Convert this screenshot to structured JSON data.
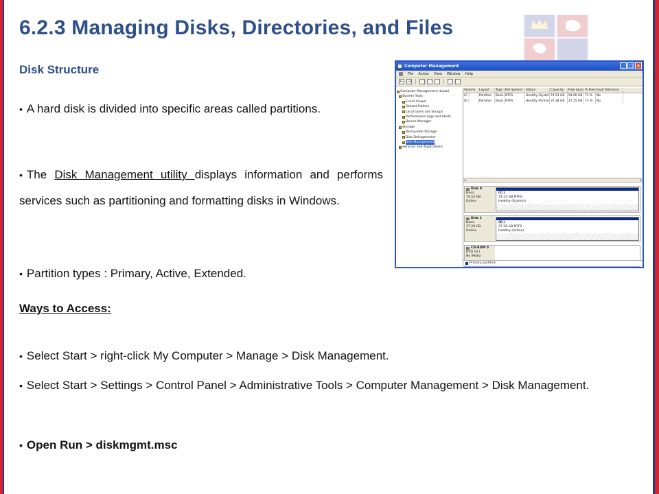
{
  "slide": {
    "title": "6.2.3 Managing Disks, Directories, and Files",
    "subhead": "Disk Structure",
    "bullets": {
      "b1": "A hard disk is divided into specific areas called partitions.",
      "b2_pre": "The ",
      "b2_link": "Disk Management utility ",
      "b2_post": "displays information and performs services such as partitioning and formatting disks in Windows.",
      "b3": "Partition types : Primary, Active, Extended."
    },
    "ways_heading": "Ways to Access:",
    "access": {
      "a1": "Select Start > right-click My Computer > Manage > Disk Management.",
      "a2": "Select Start > Settings > Control Panel > Administrative Tools > Computer Management > Disk Management.",
      "a3": "Open Run > diskmgmt.msc"
    },
    "bullet_glyph": "•"
  },
  "window": {
    "title": "Computer Management",
    "controls": {
      "min": "_",
      "max": "□",
      "close": "x"
    },
    "menu": [
      "File",
      "Action",
      "View",
      "Window",
      "Help"
    ],
    "tree": [
      "Computer Management (Local)",
      "System Tools",
      "Event Viewer",
      "Shared Folders",
      "Local Users and Groups",
      "Performance Logs and Alerts",
      "Device Manager",
      "Storage",
      "Removable Storage",
      "Disk Defragmenter",
      "Disk Management",
      "Services and Applications"
    ],
    "vol_headers": [
      "Volume",
      "Layout",
      "Type",
      "File System",
      "Status",
      "Capacity",
      "Free Space",
      "% Free",
      "Fault Tolerance"
    ],
    "vol_rows": [
      [
        "(C:)",
        "Partition",
        "Basic",
        "NTFS",
        "Healthy (System)",
        "74.53 GB",
        "54.90 GB",
        "73 %",
        "No"
      ],
      [
        "(E:)",
        "Partition",
        "Basic",
        "NTFS",
        "Healthy (Active)",
        "37.28 GB",
        "27.25 GB",
        "73 %",
        "No"
      ]
    ],
    "disks": [
      {
        "name": "Disk 0",
        "l1": "Basic",
        "l2": "74.53 GB",
        "l3": "Online",
        "part_name": "(C:)",
        "part_l1": "74.53 GB NTFS",
        "part_l2": "Healthy (System)"
      },
      {
        "name": "Disk 1",
        "l1": "Basic",
        "l2": "37.28 GB",
        "l3": "Online",
        "part_name": "(E:)",
        "part_l1": "37.28 GB NTFS",
        "part_l2": "Healthy (Active)"
      },
      {
        "name": "CD-ROM 0",
        "l1": "DVD (D:)",
        "l2": "",
        "l3": "No Media"
      }
    ],
    "legend": "Primary partition",
    "colors": {
      "titlebar": "#2a56c6",
      "primary_partition": "#102a8a"
    }
  },
  "theme": {
    "title_color": "#2e4f8a",
    "frame_red": "#d8232a",
    "frame_blue": "#1f3a8a"
  }
}
